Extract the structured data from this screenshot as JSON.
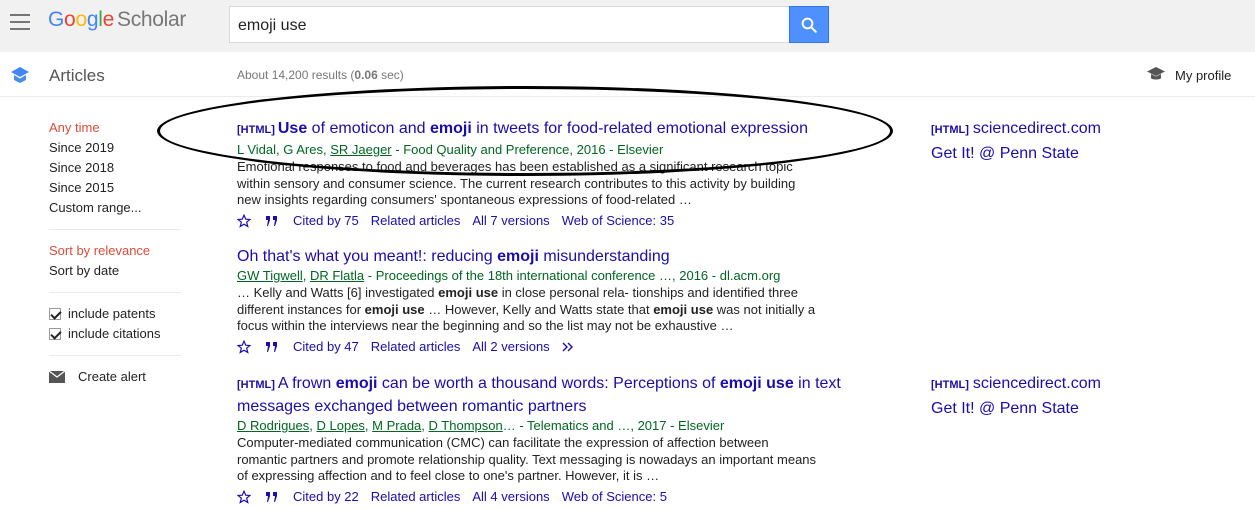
{
  "header": {
    "logo": {
      "G": "G",
      "o1": "o",
      "o2": "o",
      "g": "g",
      "l": "l",
      "e": "e",
      "scholar": "Scholar"
    },
    "search_value": "emoji use"
  },
  "subheader": {
    "section": "Articles",
    "results_prefix": "About 14,200 results (",
    "results_time": "0.06",
    "results_suffix": " sec)",
    "profile": "My profile"
  },
  "sidebar": {
    "time_filters": [
      "Any time",
      "Since 2019",
      "Since 2018",
      "Since 2015",
      "Custom range..."
    ],
    "sort": [
      "Sort by relevance",
      "Sort by date"
    ],
    "checks": [
      "include patents",
      "include citations"
    ],
    "alert": "Create alert"
  },
  "results": [
    {
      "tag": "[HTML]",
      "title_parts": [
        [
          "Use",
          true
        ],
        [
          " of emoticon and ",
          false
        ],
        [
          "emoji",
          true
        ],
        [
          " in tweets for food-related emotional expression",
          false
        ]
      ],
      "authors_parts": [
        [
          "L Vidal, G Ares, ",
          false
        ],
        [
          "SR Jaeger",
          true
        ],
        [
          " - Food Quality and Preference, 2016 - Elsevier",
          false
        ]
      ],
      "snippet": "Emotional responses to food and beverages has been established as a significant research topic within sensory and consumer science. The current research contributes to this activity by building new insights regarding consumers' spontaneous expressions of food-related …",
      "cited": "Cited by 75",
      "related": "Related articles",
      "versions": "All 7 versions",
      "wos": "Web of Science: 35"
    },
    {
      "tag": "",
      "title_parts": [
        [
          "Oh that's what you meant!: reducing ",
          false
        ],
        [
          "emoji",
          true
        ],
        [
          " misunderstanding",
          false
        ]
      ],
      "authors_parts": [
        [
          "GW Tigwell",
          true
        ],
        [
          ", ",
          false
        ],
        [
          "DR Flatla",
          true
        ],
        [
          " - Proceedings of the 18th international conference …, 2016 - dl.acm.org",
          false
        ]
      ],
      "snippet_parts": [
        [
          "… Kelly and Watts [6] investigated ",
          false
        ],
        [
          "emoji use",
          true
        ],
        [
          " in close personal rela- tionships and identified three different instances for ",
          false
        ],
        [
          "emoji use",
          true
        ],
        [
          " … However, Kelly and Watts state that ",
          false
        ],
        [
          "emoji use",
          true
        ],
        [
          " was not initially a focus within the interviews near the beginning and so the list may not be exhaustive …",
          false
        ]
      ],
      "cited": "Cited by 47",
      "related": "Related articles",
      "versions": "All 2 versions",
      "wos": ""
    },
    {
      "tag": "[HTML]",
      "title_parts": [
        [
          "A frown ",
          false
        ],
        [
          "emoji",
          true
        ],
        [
          " can be worth a thousand words: Perceptions of ",
          false
        ],
        [
          "emoji use",
          true
        ],
        [
          " in text messages exchanged between romantic partners",
          false
        ]
      ],
      "authors_parts": [
        [
          "D Rodrigues",
          true
        ],
        [
          ", ",
          false
        ],
        [
          "D Lopes",
          true
        ],
        [
          ", ",
          false
        ],
        [
          "M Prada",
          true
        ],
        [
          ", ",
          false
        ],
        [
          "D Thompson",
          true
        ],
        [
          "… - Telematics and …, 2017 - Elsevier",
          false
        ]
      ],
      "snippet": "Computer-mediated communication (CMC) can facilitate the expression of affection between romantic partners and promote relationship quality. Text messaging is nowadays an important means of expressing affection and to feel close to one's partner. However, it is …",
      "cited": "Cited by 22",
      "related": "Related articles",
      "versions": "All 4 versions",
      "wos": "Web of Science: 5"
    }
  ],
  "side_links": [
    {
      "tag": "[HTML]",
      "source": "sciencedirect.com",
      "getit": "Get It! @ Penn State"
    },
    {
      "tag": "[HTML]",
      "source": "sciencedirect.com",
      "getit": "Get It! @ Penn State"
    }
  ],
  "colors": {
    "link": "#1a0dab",
    "green": "#006621",
    "active": "#dd4b39",
    "search_button": "#4d90fe"
  },
  "icons": [
    "menu-icon",
    "search-icon",
    "articles-icon",
    "profile-icon",
    "star-icon",
    "quote-icon",
    "more-icon",
    "mail-icon"
  ]
}
